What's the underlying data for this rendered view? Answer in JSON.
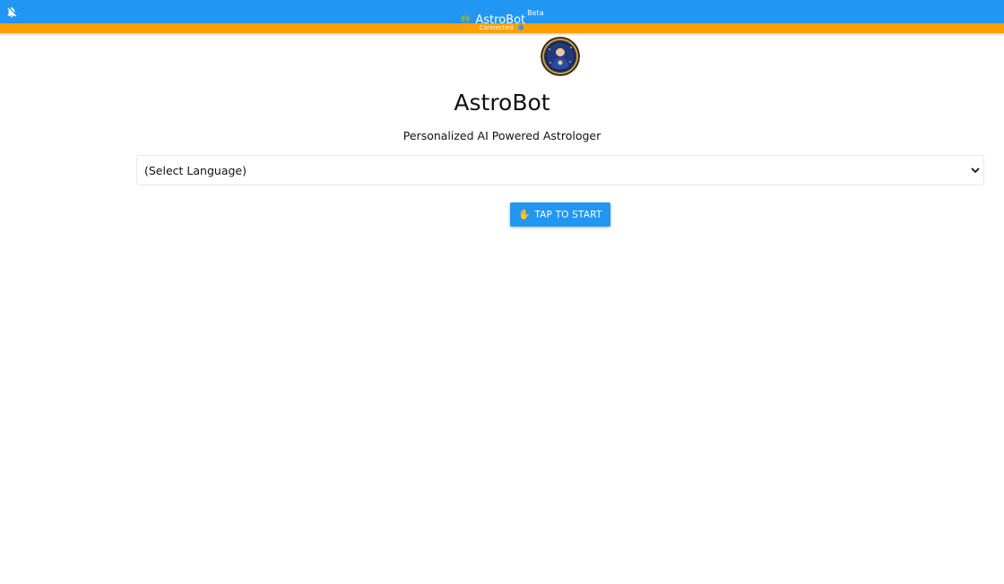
{
  "header": {
    "title": "AstroBot",
    "badge": "Beta",
    "notifications_icon": "bell-off-icon",
    "globe_icon": "globe-icon"
  },
  "status": {
    "text": "Connected",
    "icon": "globe-icon"
  },
  "main": {
    "avatar_icon": "astrologer-avatar",
    "title": "AstroBot",
    "subtitle": "Personalized AI Powered Astrologer",
    "language_select": {
      "selected": "(Select Language)"
    },
    "start_button": {
      "emoji": "✋",
      "label": "TAP TO START"
    }
  },
  "colors": {
    "primary": "#2196f3",
    "status_bar": "#ffa000"
  }
}
